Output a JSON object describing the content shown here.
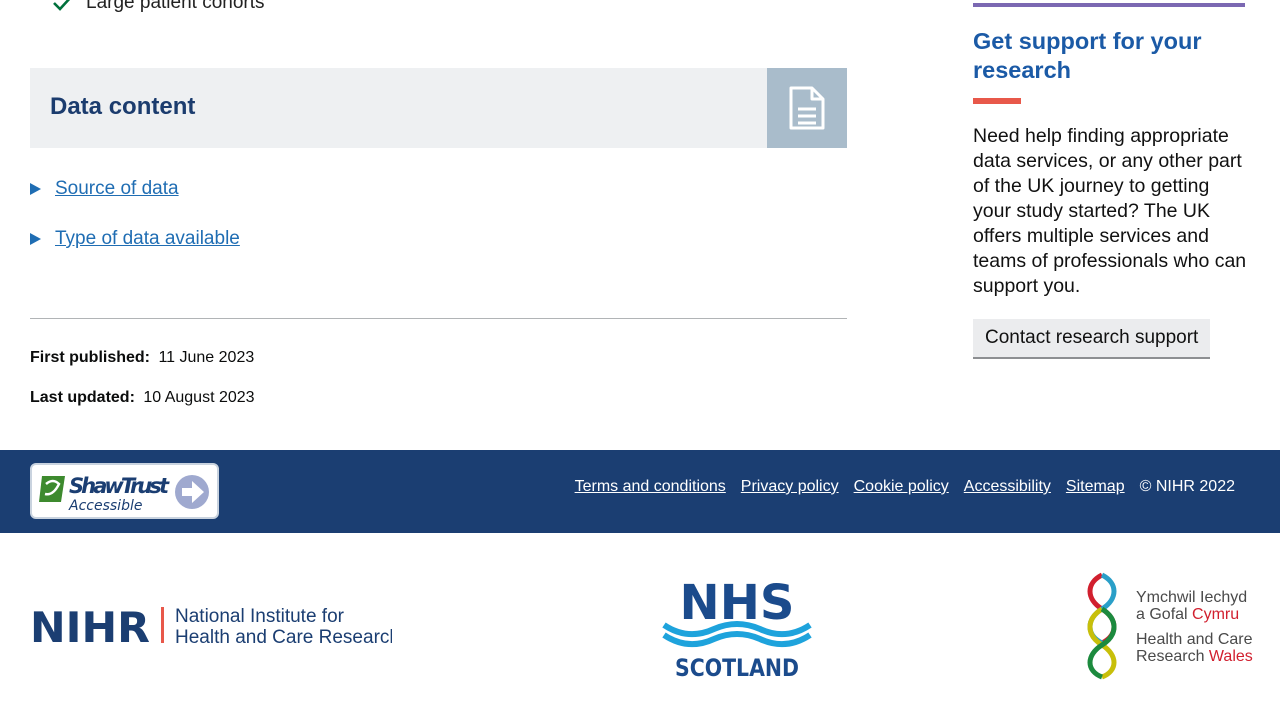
{
  "main": {
    "checklist_item": "Large patient cohorts",
    "card_title": "Data content",
    "details": [
      {
        "label": "Source of data"
      },
      {
        "label": "Type of data available"
      }
    ],
    "meta": {
      "first_published_label": "First published:",
      "first_published_value": "11 June 2023",
      "last_updated_label": "Last updated:",
      "last_updated_value": "10 August 2023"
    }
  },
  "aside": {
    "title": "Get support for your research",
    "text": "Need help finding appropriate data services, or any other part of the UK journey to getting your study started? The UK offers multiple services and teams of professionals who can support you.",
    "button_label": "Contact research support"
  },
  "footer": {
    "shaw_logo": {
      "name": "ShawTrust",
      "sub": "Accessible"
    },
    "links": [
      "Terms and conditions",
      "Privacy policy",
      "Cookie policy",
      "Accessibility",
      "Sitemap"
    ],
    "copyright": "© NIHR 2022"
  },
  "partner_logos": {
    "nihr": {
      "acronym": "NIHR",
      "line1": "National Institute for",
      "line2": "Health and Care Research"
    },
    "nhs": {
      "acronym": "NHS",
      "sub": "SCOTLAND"
    },
    "hcrw": {
      "line1": "Ymchwil Iechyd",
      "line2a": "a Gofal ",
      "line2b": "Cymru",
      "line3": "Health and Care",
      "line4a": "Research ",
      "line4b": "Wales"
    }
  },
  "colors": {
    "brand_blue": "#1b3e72",
    "link_blue": "#1f6db3",
    "accent_red": "#e8584a",
    "accent_purple": "#7b68b2",
    "check_green": "#00703c"
  },
  "icons": {
    "checkmark": "check-icon",
    "card": "document-icon",
    "details_toggle": "triangle-right-icon"
  }
}
